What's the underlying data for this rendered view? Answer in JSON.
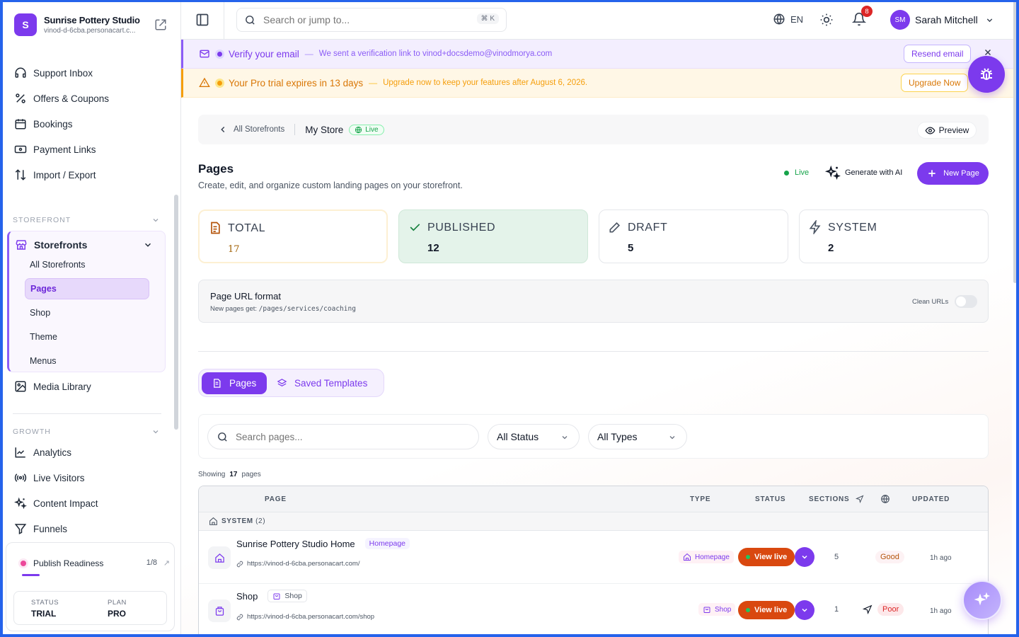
{
  "org": {
    "initial": "S",
    "name": "Sunrise Pottery Studio",
    "subdomain": "vinod-d-6cba.personacart.c..."
  },
  "nav": {
    "top_items": [
      {
        "label": "Support Inbox",
        "icon": "headset-icon"
      },
      {
        "label": "Offers & Coupons",
        "icon": "percent-icon"
      },
      {
        "label": "Bookings",
        "icon": "calendar-icon"
      },
      {
        "label": "Payment Links",
        "icon": "payment-link-icon"
      },
      {
        "label": "Import / Export",
        "icon": "import-export-icon"
      }
    ],
    "storefront_section": "STOREFRONT",
    "storefronts_label": "Storefronts",
    "storefront_sub": [
      "All Storefronts",
      "Pages",
      "Shop",
      "Theme",
      "Menus"
    ],
    "media_library": "Media Library",
    "growth_section": "GROWTH",
    "growth_items": [
      {
        "label": "Analytics",
        "icon": "analytics-icon"
      },
      {
        "label": "Live Visitors",
        "icon": "broadcast-icon"
      },
      {
        "label": "Content Impact",
        "icon": "sparkle-icon"
      },
      {
        "label": "Funnels",
        "icon": "funnel-icon"
      }
    ]
  },
  "readiness": {
    "label": "Publish Readiness",
    "count": "1/8",
    "progress": 0.125,
    "status_key": "STATUS",
    "status_val": "TRIAL",
    "plan_key": "PLAN",
    "plan_val": "PRO"
  },
  "topbar": {
    "search_placeholder": "Search or jump to...",
    "shortcut": "⌘ K",
    "lang": "EN",
    "notif_count": "8",
    "user_initials": "SM",
    "user_name": "Sarah Mitchell"
  },
  "banners": {
    "verify": {
      "title": "Verify your email",
      "sep": "—",
      "desc": "We sent a verification link to vinod+docsdemo@vinodmorya.com",
      "button": "Resend email"
    },
    "trial": {
      "title": "Your Pro trial expires in 13 days",
      "sep": "—",
      "desc": "Upgrade now to keep your features after August 6, 2026.",
      "button": "Upgrade Now"
    }
  },
  "breadcrumb": {
    "parent": "All Storefronts",
    "current": "My Store",
    "status": "Live",
    "preview": "Preview"
  },
  "page": {
    "title": "Pages",
    "subtitle": "Create, edit, and organize custom landing pages on your storefront.",
    "live": "Live",
    "generate": "Generate with AI",
    "new_page": "New Page"
  },
  "stats": [
    {
      "label": "TOTAL",
      "value": "17"
    },
    {
      "label": "PUBLISHED",
      "value": "12"
    },
    {
      "label": "DRAFT",
      "value": "5"
    },
    {
      "label": "SYSTEM",
      "value": "2"
    }
  ],
  "url_format": {
    "title": "Page URL format",
    "desc_prefix": "New pages get: ",
    "path": "/pages/services/coaching",
    "toggle_label": "Clean URLs",
    "toggle_on": false
  },
  "tabs": {
    "pages": "Pages",
    "templates": "Saved Templates"
  },
  "filters": {
    "search_placeholder": "Search pages...",
    "status": "All Status",
    "types": "All Types"
  },
  "showing": {
    "prefix": "Showing",
    "count": "17",
    "suffix": "pages"
  },
  "table": {
    "headers": {
      "page": "PAGE",
      "type": "TYPE",
      "status": "STATUS",
      "sections": "SECTIONS",
      "updated": "UPDATED"
    },
    "group": "SYSTEM",
    "group_count": "(2)",
    "rows": [
      {
        "name": "Sunrise Pottery Studio Home",
        "tag": "Homepage",
        "url": "https://vinod-d-6cba.personacart.com/",
        "type": "Homepage",
        "status": "View live",
        "sections": "5",
        "seo": "Good",
        "updated": "1h ago"
      },
      {
        "name": "Shop",
        "tag": "Shop",
        "url": "https://vinod-d-6cba.personacart.com/shop",
        "type": "Shop",
        "status": "View live",
        "sections": "1",
        "seo": "Poor",
        "updated": "1h ago"
      }
    ]
  }
}
